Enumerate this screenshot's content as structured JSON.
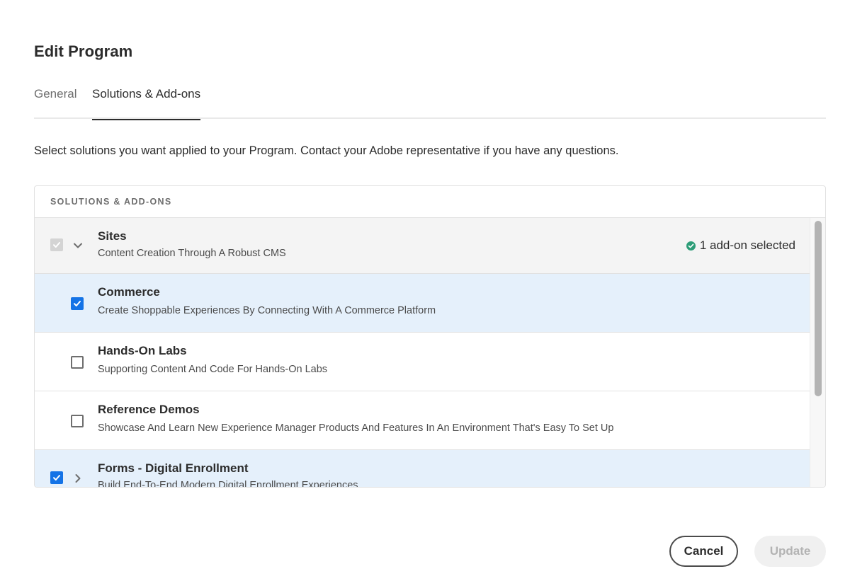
{
  "dialog": {
    "title": "Edit Program",
    "tabs": [
      {
        "label": "General",
        "selected": false
      },
      {
        "label": "Solutions & Add-ons",
        "selected": true
      }
    ],
    "description": "Select solutions you want applied to your Program. Contact your Adobe representative if you have any questions.",
    "table": {
      "header": "SOLUTIONS & ADD-ONS",
      "rows": [
        {
          "title": "Sites",
          "subtitle": "Content Creation Through A Robust CMS",
          "status": "1 add-on selected"
        },
        {
          "title": "Commerce",
          "subtitle": "Create Shoppable Experiences By Connecting With A Commerce Platform",
          "checked": true
        },
        {
          "title": "Hands-On Labs",
          "subtitle": "Supporting Content And Code For Hands-On Labs",
          "checked": false
        },
        {
          "title": "Reference Demos",
          "subtitle": "Showcase And Learn New Experience Manager Products And Features In An Environment That's Easy To Set Up",
          "checked": false
        },
        {
          "title": "Forms - Digital Enrollment",
          "subtitle": "Build End-To-End Modern Digital Enrollment Experiences",
          "checked": true
        }
      ]
    },
    "buttons": {
      "cancel": "Cancel",
      "update": "Update"
    }
  },
  "colors": {
    "accent": "#1473e6",
    "success": "#2d9d78",
    "selected_row": "#e5f0fb"
  }
}
